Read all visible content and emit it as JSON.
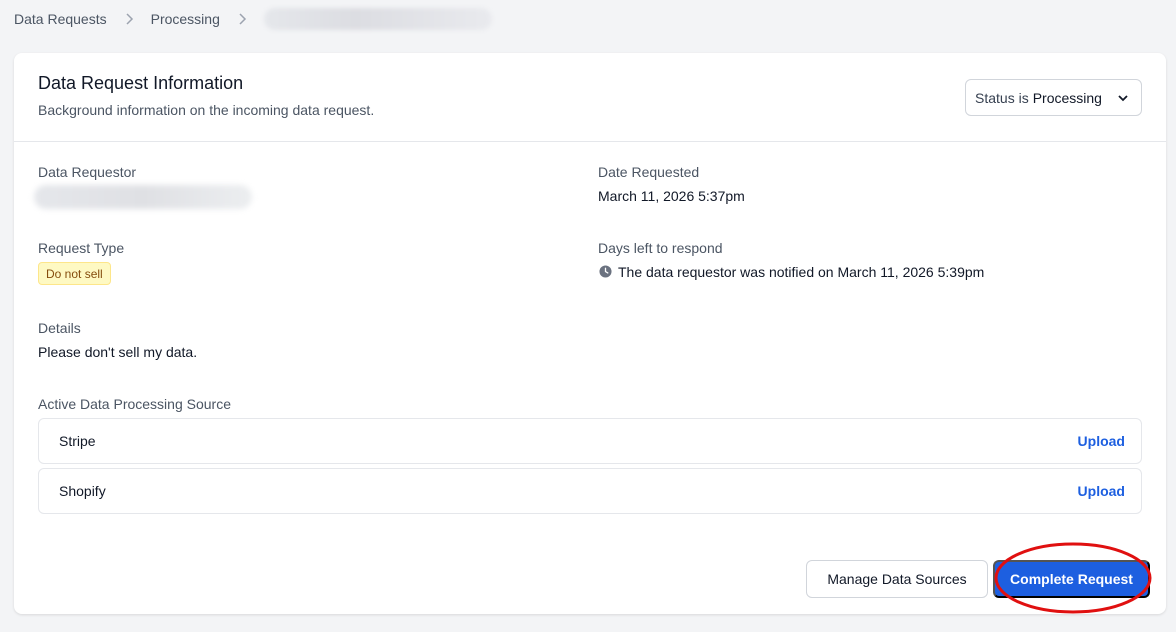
{
  "breadcrumb": {
    "items": [
      "Data Requests",
      "Processing"
    ]
  },
  "card": {
    "title": "Data Request Information",
    "subtitle": "Background information on the incoming data request.",
    "status_prefix": "Status is",
    "status_value": "Processing"
  },
  "fields": {
    "requestor_label": "Data Requestor",
    "date_label": "Date Requested",
    "date_value": "March 11, 2026 5:37pm",
    "type_label": "Request Type",
    "type_badge": "Do not sell",
    "days_label": "Days left to respond",
    "days_value": "The data requestor was notified on March 11, 2026 5:39pm",
    "details_label": "Details",
    "details_value": "Please don't sell my data."
  },
  "sources": {
    "label": "Active Data Processing Source",
    "items": [
      {
        "name": "Stripe",
        "action": "Upload"
      },
      {
        "name": "Shopify",
        "action": "Upload"
      }
    ]
  },
  "actions": {
    "manage_label": "Manage Data Sources",
    "complete_label": "Complete Request"
  },
  "colors": {
    "primary": "#1d5fe0",
    "badge_bg": "#fef9c3",
    "badge_text": "#854d0e",
    "annotation": "#e01010"
  },
  "icons": {
    "breadcrumb_separator": "chevron-right-icon",
    "status_dropdown": "chevron-down-icon",
    "days_left": "clock-icon"
  }
}
